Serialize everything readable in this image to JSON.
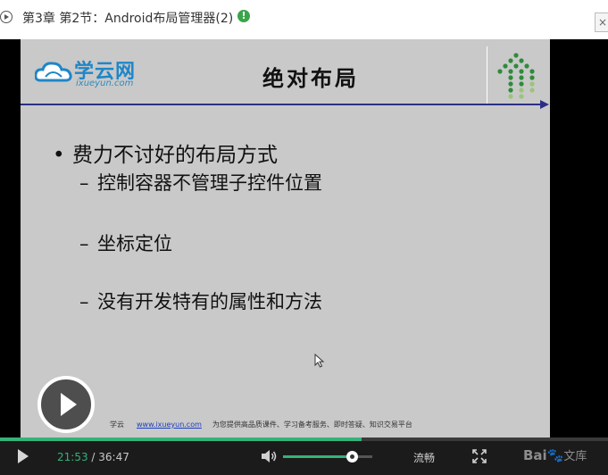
{
  "header": {
    "title": "第3章 第2节：Android布局管理器(2)",
    "info_icon": "!",
    "close_label": "×"
  },
  "slide": {
    "logo_text": "学云网",
    "logo_sub": "ixueyun.com",
    "title": "绝对布局",
    "bullet_marker": "•",
    "bullet": "费力不讨好的布局方式",
    "sub_marker": "–",
    "sub_items": [
      "控制容器不管理子控件位置",
      "坐标定位",
      "没有开发特有的属性和方法"
    ],
    "footer_brand": "学云",
    "footer_link": "www.ixueyun.com",
    "footer_text": "为您提供高品质课件、学习备考服务、即时答疑、知识交易平台"
  },
  "player": {
    "current_time": "21:53",
    "separator": " / ",
    "duration": "36:47",
    "progress_fraction": 0.595,
    "volume_fraction": 0.77,
    "quality_label": "流畅",
    "watermark_logo": "Bai",
    "watermark_suffix": "文库",
    "accent_color": "#35b27a"
  }
}
